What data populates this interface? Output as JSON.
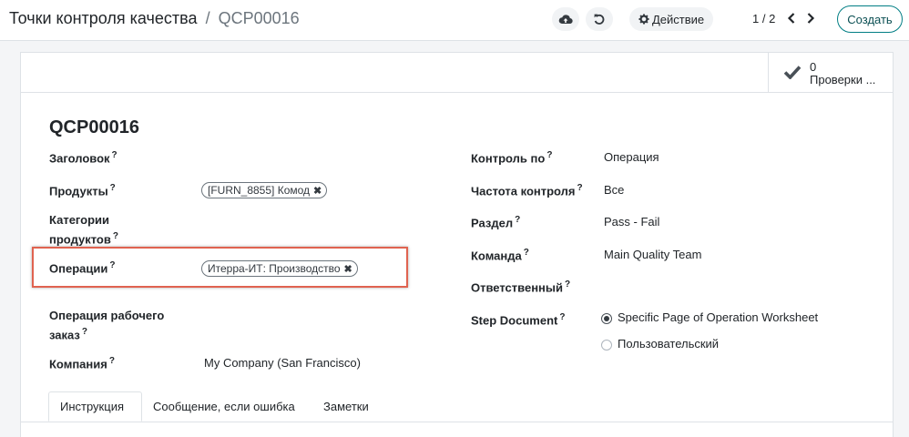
{
  "breadcrumb": {
    "parent": "Точки контроля качества",
    "separator": "/",
    "current": "QCP00016"
  },
  "toolbar": {
    "save_icon": "cloud-upload-icon",
    "discard_icon": "undo-icon",
    "action_icon": "gear-icon",
    "action_label": "Действие",
    "pager": "1 / 2",
    "create_label": "Создать"
  },
  "smart_button": {
    "icon": "check-icon",
    "value": "0",
    "label": "Проверки ..."
  },
  "record": {
    "title": "QCP00016"
  },
  "left_fields": {
    "title_label": "Заголовок",
    "products_label": "Продукты",
    "products_tag": "[FURN_8855] Комод",
    "categories_label_line1": "Категории",
    "categories_label_line2": "продуктов",
    "operations_label": "Операции",
    "operations_tag": "Итерра-ИТ: Производство",
    "workorder_label_line1": "Операция рабочего",
    "workorder_label_line2": "заказ",
    "company_label": "Компания",
    "company_value": "My Company (San Francisco)"
  },
  "right_fields": {
    "control_by_label": "Контроль по",
    "control_by_value": "Операция",
    "frequency_label": "Частота контроля",
    "frequency_value": "Все",
    "section_label": "Раздел",
    "section_value": "Pass - Fail",
    "team_label": "Команда",
    "team_value": "Main Quality Team",
    "responsible_label": "Ответственный",
    "step_document_label": "Step Document",
    "step_document_options": [
      {
        "label": "Specific Page of Operation Worksheet",
        "checked": true
      },
      {
        "label": "Пользовательский",
        "checked": false
      }
    ]
  },
  "help_marker": "?",
  "tag_remove": "✖",
  "tabs": [
    {
      "label": "Инструкция",
      "active": true
    },
    {
      "label": "Сообщение, если ошибка",
      "active": false
    },
    {
      "label": "Заметки",
      "active": false
    }
  ],
  "colors": {
    "accent": "#017e84",
    "highlight": "#e06350"
  }
}
